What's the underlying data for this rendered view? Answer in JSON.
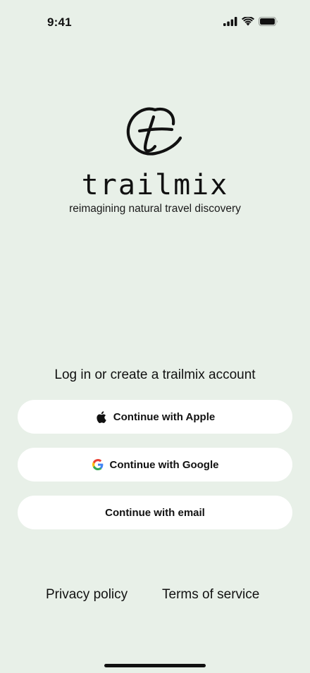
{
  "status_bar": {
    "time": "9:41",
    "icons": [
      "cellular-signal-icon",
      "wifi-icon",
      "battery-icon"
    ]
  },
  "brand": {
    "logo_icon": "trailmix-t-logo-icon",
    "name": "trailmix",
    "tagline": "reimagining natural travel discovery"
  },
  "auth": {
    "heading": "Log in or create a trailmix account",
    "apple_label": "Continue with Apple",
    "apple_icon": "apple-icon",
    "google_label": "Continue with Google",
    "google_icon": "google-icon",
    "email_label": "Continue with email"
  },
  "footer": {
    "privacy_label": "Privacy policy",
    "terms_label": "Terms of service"
  },
  "colors": {
    "background": "#E8F0E8",
    "button_background": "#FFFFFF",
    "text": "#111111",
    "google_blue": "#4285F4",
    "google_red": "#EA4335",
    "google_yellow": "#FBBC05",
    "google_green": "#34A853"
  }
}
